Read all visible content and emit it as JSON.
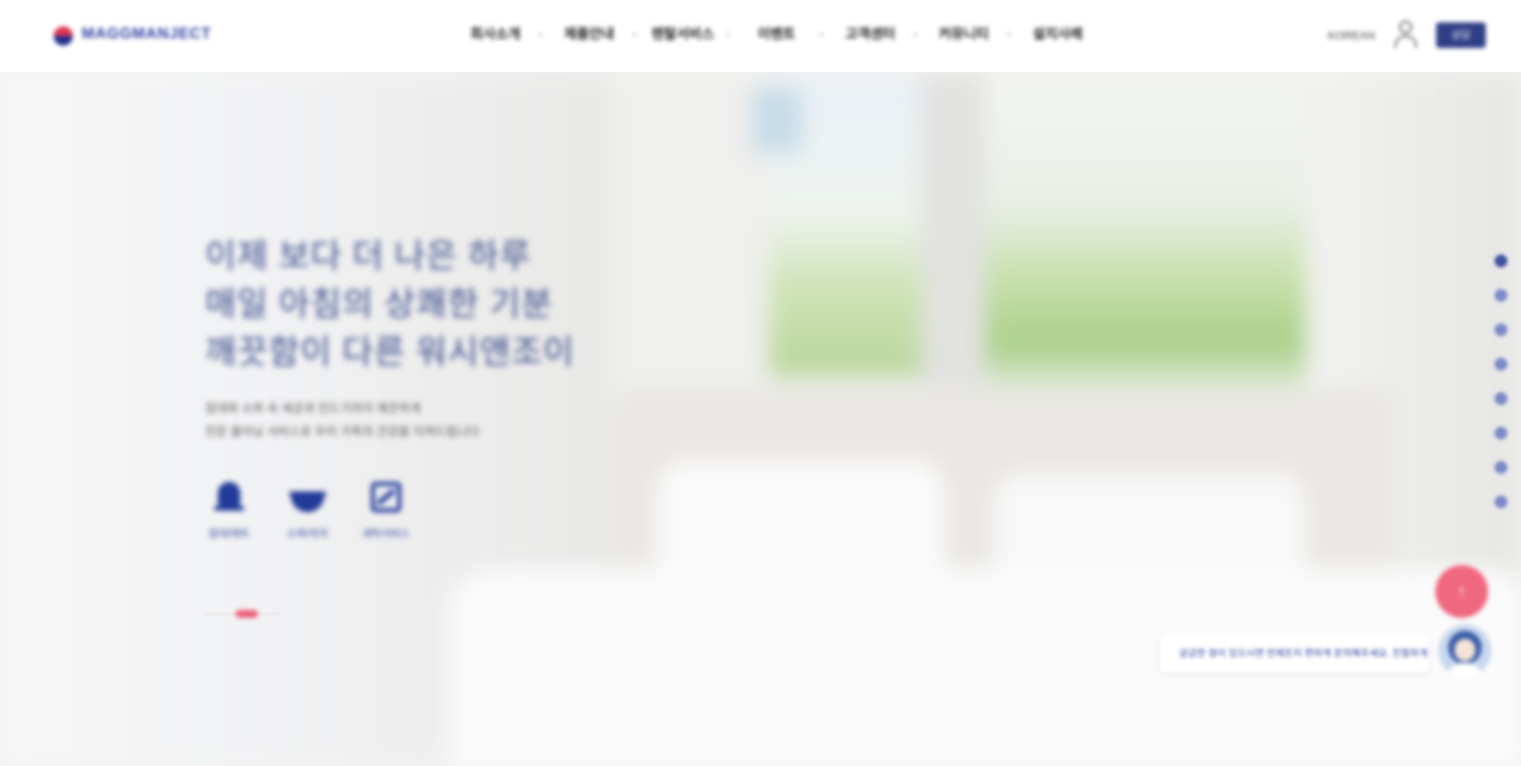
{
  "header": {
    "logo_text": "MAGGMANJECT",
    "nav": [
      {
        "label": "회사소개"
      },
      {
        "label": "제품안내"
      },
      {
        "label": "렌탈서비스"
      },
      {
        "label": "이벤트"
      },
      {
        "label": "고객센터"
      },
      {
        "label": "커뮤니티"
      },
      {
        "label": "설치사례"
      }
    ],
    "lang_label": "KOREAN",
    "user_icon": "user-icon",
    "cta_label": "상담"
  },
  "hero": {
    "title_lines": [
      "이제 보다 더 나은 하루",
      "매일 아침의 상쾌한 기분",
      "깨끗함이 다른 워시앤조이"
    ],
    "desc_lines": [
      "침대와 소파 속 세균과 진드기까지 깨끗하게",
      "전문 클리닝 서비스로 우리 가족의 건강을 지켜드립니다"
    ],
    "features": [
      {
        "label": "침대/매트",
        "icon": "bell-icon"
      },
      {
        "label": "소파/의자",
        "icon": "bowl-icon"
      },
      {
        "label": "세탁서비스",
        "icon": "wash-icon"
      }
    ],
    "slide_progress": 0.3
  },
  "side_dots": {
    "count": 8,
    "active_index": 0
  },
  "floating": {
    "top_button_label": "↑",
    "chat_text": "궁금한 점이 있으시면 언제든지 편하게 문의해주세요. 친절하게 상담해 드리겠습니다",
    "avatar_icon": "consultant-avatar-icon"
  },
  "colors": {
    "brand": "#2c3f9f",
    "accent": "#f06880",
    "cta": "#2f3f86"
  }
}
